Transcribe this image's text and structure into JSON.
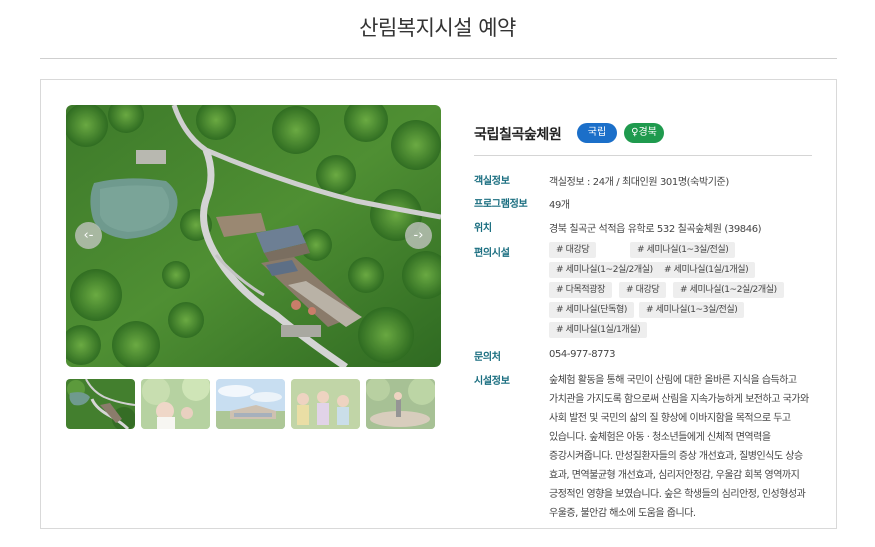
{
  "page": {
    "title": "산림복지시설 예약"
  },
  "facility": {
    "name": "국립칠곡숲체원",
    "type_badge": "국립",
    "region_badge": "♀경북",
    "colors": {
      "type_badge": "#1b6fc9",
      "region_badge": "#1f9a4e",
      "label": "#1a6e80"
    }
  },
  "gallery": {
    "prev_icon": "‹-",
    "next_icon": "-›",
    "thumbnails": [
      "aerial-view",
      "forest-activity",
      "building-sky",
      "group-activity",
      "forest-deck"
    ]
  },
  "details": {
    "room_info": {
      "label": "객실정보",
      "value": "객실정보 : 24개 / 최대인원 301명(숙박기준)"
    },
    "program_info": {
      "label": "프로그램정보",
      "value": "49개"
    },
    "location": {
      "label": "위치",
      "value": "경북 칠곡군 석적읍 유학로 532 칠곡숲체원 (39846)"
    },
    "amenities": {
      "label": "편의시설",
      "tags": [
        "# 대강당",
        "# 세미나실(1~3실/전실)",
        "# 세미나실(1~2실/2개실)",
        "# 세미나실(1실/1개실)",
        "# 다목적광장",
        "# 대강당",
        "# 세미나실(1~2실/2개실)",
        "# 세미나실(단독형)",
        "# 세미나실(1~3실/전실)",
        "# 세미나실(1실/1개실)"
      ]
    },
    "contact": {
      "label": "문의처",
      "value": "054-977-8773"
    },
    "description": {
      "label": "시설정보",
      "text": "숲체험 활동을 통해 국민이 산림에 대한 올바른 지식을 습득하고 가치관을 가지도록 함으로써 산림을 지속가능하게 보전하고 국가와 사회 발전 및 국민의 삶의 질 향상에 이바지함을 목적으로 두고 있습니다. 숲체험은 아동 · 청소년들에게 신체적 면역력을 증강시켜줍니다. 만성질환자들의 증상 개선효과, 질병인식도 상승 효과, 면역불균형 개선효과, 심리저안정감, 우울감 회복 영역까지 긍정적인 영향을 보였습니다. 숲은 학생들의 심리안정, 인성형성과 우울증, 불안감 해소에 도움을 줍니다."
    }
  }
}
